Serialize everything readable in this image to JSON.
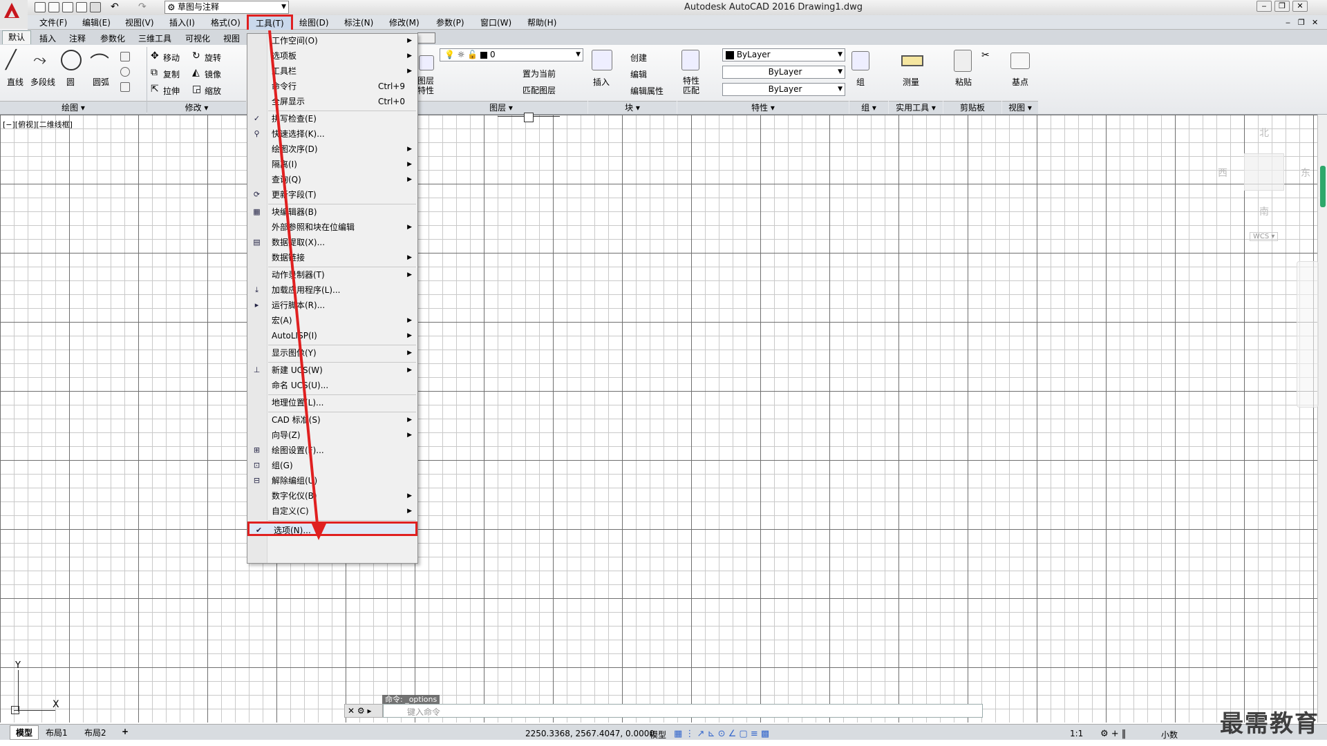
{
  "titlebar": {
    "workspace": "草图与注释",
    "title": "Autodesk AutoCAD 2016    Drawing1.dwg"
  },
  "menubar": [
    "文件(F)",
    "编辑(E)",
    "视图(V)",
    "插入(I)",
    "格式(O)",
    "工具(T)",
    "绘图(D)",
    "标注(N)",
    "修改(M)",
    "参数(P)",
    "窗口(W)",
    "帮助(H)"
  ],
  "ribbon_tabs": [
    "默认",
    "插入",
    "注释",
    "参数化",
    "三维工具",
    "可视化",
    "视图"
  ],
  "ribbon": {
    "draw": [
      "直线",
      "多段线",
      "圆",
      "圆弧"
    ],
    "modify": [
      "移动",
      "旋转",
      "复制",
      "镜像",
      "拉伸",
      "缩放"
    ],
    "layer_prop": "图层\n特性",
    "layer_value": "0",
    "layer_cmds": [
      "置为当前",
      "匹配图层"
    ],
    "insert": "插入",
    "block_cmds": [
      "创建",
      "编辑",
      "编辑属性"
    ],
    "match_prop": "特性\n匹配",
    "bylayer": [
      "ByLayer",
      "ByLayer",
      "ByLayer"
    ],
    "group": "组",
    "measure": "测量",
    "paste": "粘贴",
    "basepoint": "基点",
    "panels": [
      "绘图",
      "修改",
      "图层",
      "块",
      "特性",
      "组",
      "实用工具",
      "剪贴板",
      "视图"
    ]
  },
  "viewport_label": "[−][俯视][二维线框]",
  "tools_menu": {
    "items": [
      {
        "label": "工作空间(O)",
        "arrow": true
      },
      {
        "label": "选项板",
        "arrow": true
      },
      {
        "label": "工具栏",
        "arrow": true
      },
      {
        "label": "命令行",
        "shortcut": "Ctrl+9"
      },
      {
        "label": "全屏显示",
        "shortcut": "Ctrl+0"
      },
      {
        "sep": true
      },
      {
        "label": "拼写检查(E)"
      },
      {
        "label": "快速选择(K)..."
      },
      {
        "label": "绘图次序(D)",
        "arrow": true
      },
      {
        "label": "隔离(I)",
        "arrow": true
      },
      {
        "label": "查询(Q)",
        "arrow": true
      },
      {
        "label": "更新字段(T)"
      },
      {
        "sep": true
      },
      {
        "label": "块编辑器(B)"
      },
      {
        "label": "外部参照和块在位编辑",
        "arrow": true
      },
      {
        "label": "数据提取(X)..."
      },
      {
        "label": "数据链接",
        "arrow": true
      },
      {
        "sep": true
      },
      {
        "label": "动作录制器(T)",
        "arrow": true
      },
      {
        "label": "加载应用程序(L)..."
      },
      {
        "label": "运行脚本(R)..."
      },
      {
        "label": "宏(A)",
        "arrow": true
      },
      {
        "label": "AutoLISP(I)",
        "arrow": true
      },
      {
        "sep": true
      },
      {
        "label": "显示图像(Y)",
        "arrow": true
      },
      {
        "sep": true
      },
      {
        "label": "新建 UCS(W)",
        "arrow": true
      },
      {
        "label": "命名 UCS(U)..."
      },
      {
        "sep": true
      },
      {
        "label": "地理位置(L)..."
      },
      {
        "sep": true
      },
      {
        "label": "CAD 标准(S)",
        "arrow": true
      },
      {
        "label": "向导(Z)",
        "arrow": true
      },
      {
        "label": "绘图设置(F)..."
      },
      {
        "label": "组(G)"
      },
      {
        "label": "解除编组(U)"
      },
      {
        "label": "数字化仪(B)",
        "arrow": true
      },
      {
        "label": "自定义(C)",
        "arrow": true
      },
      {
        "sep": true
      },
      {
        "label": "选项(N)...",
        "highlight": true
      }
    ]
  },
  "viewcube": {
    "north": "北",
    "west": "西",
    "east": "东",
    "south": "南",
    "wcs": "WCS"
  },
  "command": {
    "history": "命令: _options",
    "placeholder": "键入命令"
  },
  "layout_tabs": [
    "模型",
    "布局1",
    "布局2"
  ],
  "status": {
    "coords": "2250.3368, 2567.4047, 0.0000",
    "space": "模型",
    "scale": "1:1",
    "units": "小数"
  },
  "watermark": "最需教育",
  "colors": {
    "highlight": "#e02020",
    "accent": "#c8161d"
  }
}
